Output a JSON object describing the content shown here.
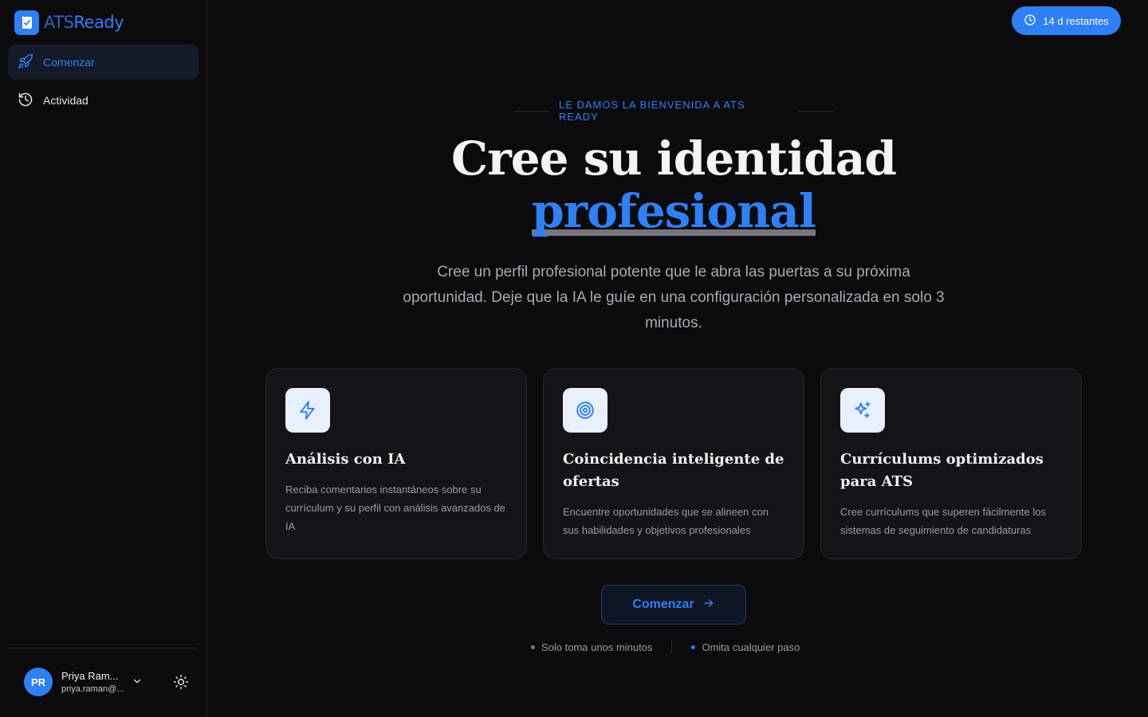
{
  "app": {
    "logo_text_a": "ATS",
    "logo_text_b": "Ready",
    "brand_color": "#2f80f5"
  },
  "sidebar": {
    "items": [
      {
        "label": "Comenzar",
        "icon": "rocket-icon",
        "active": true
      },
      {
        "label": "Actividad",
        "icon": "history-icon",
        "active": false
      }
    ]
  },
  "user": {
    "initials": "PR",
    "name": "Priya Ram...",
    "email": "priya.raman@..."
  },
  "trial": {
    "label": "14 d restantes",
    "icon": "clock-icon"
  },
  "hero": {
    "eyebrow": "LE DAMOS LA BIENVENIDA A ATS READY",
    "title_line1": "Cree su identidad",
    "title_accent": "profesional",
    "lead": "Cree un perfil profesional potente que le abra las puertas a su próxima oportunidad. Deje que la IA le guíe en una configuración personalizada en solo 3 minutos."
  },
  "features": [
    {
      "icon": "lightning-icon",
      "title": "Análisis con IA",
      "desc": "Reciba comentarios instantáneos sobre su currículum y su perfil con análisis avanzados de IA"
    },
    {
      "icon": "target-icon",
      "title": "Coincidencia inteligente de ofertas",
      "desc": "Encuentre oportunidades que se alineen con sus habilidades y objetivos profesionales"
    },
    {
      "icon": "sparkles-icon",
      "title": "Currículums optimizados para ATS",
      "desc": "Cree currículums que superen fácilmente los sistemas de seguimiento de candidaturas"
    }
  ],
  "cta": {
    "label": "Comenzar"
  },
  "notes": [
    "Solo toma unos minutos",
    "Omita cualquier paso"
  ]
}
